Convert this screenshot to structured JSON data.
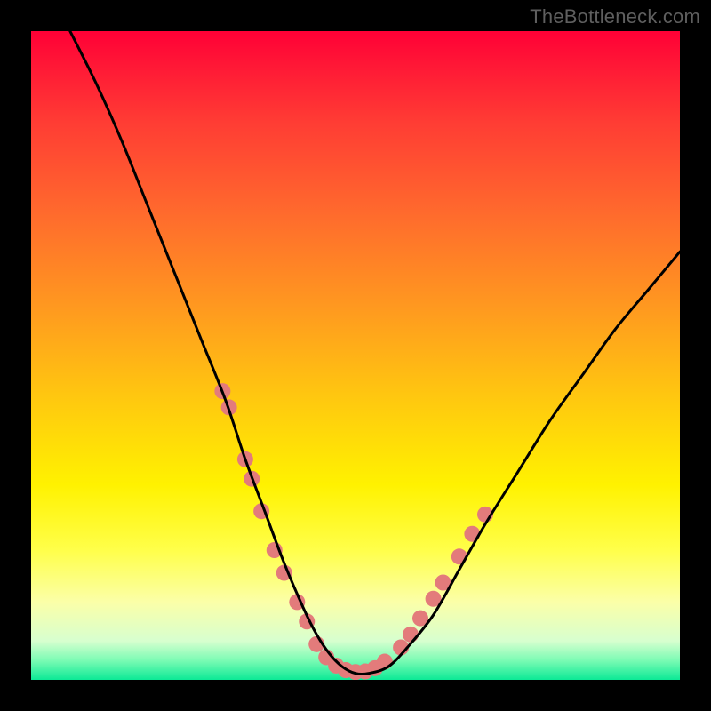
{
  "watermark": "TheBottleneck.com",
  "chart_data": {
    "type": "line",
    "title": "",
    "xlabel": "",
    "ylabel": "",
    "xlim": [
      0,
      100
    ],
    "ylim": [
      0,
      100
    ],
    "grid": false,
    "legend": false,
    "background_gradient": [
      "#ff0036",
      "#ffc610",
      "#ffff4a",
      "#0ce996"
    ],
    "series": [
      {
        "name": "bottleneck-curve",
        "color": "#000000",
        "x": [
          6,
          10,
          14,
          18,
          22,
          26,
          30,
          33,
          36,
          39,
          42,
          44,
          46,
          48,
          50,
          52,
          55,
          58,
          62,
          66,
          70,
          75,
          80,
          85,
          90,
          95,
          100
        ],
        "values": [
          100,
          92,
          83,
          73,
          63,
          53,
          43,
          34,
          26,
          18,
          11,
          7,
          4,
          2,
          1,
          1,
          2,
          5,
          10,
          17,
          24,
          32,
          40,
          47,
          54,
          60,
          66
        ]
      },
      {
        "name": "left-highlight-dots",
        "color": "#e37b7b",
        "marker": "circle",
        "x": [
          29.5,
          30.5,
          33.0,
          34.0,
          35.5,
          37.5,
          39.0,
          41.0,
          42.5
        ],
        "values": [
          44.5,
          42.0,
          34.0,
          31.0,
          26.0,
          20.0,
          16.5,
          12.0,
          9.0
        ]
      },
      {
        "name": "bottom-highlight-dots",
        "color": "#e37b7b",
        "marker": "circle",
        "x": [
          44.0,
          45.5,
          47.0,
          48.5,
          50.0,
          51.5,
          53.0,
          54.5
        ],
        "values": [
          5.5,
          3.5,
          2.2,
          1.5,
          1.2,
          1.3,
          1.8,
          2.8
        ]
      },
      {
        "name": "right-highlight-dots",
        "color": "#e37b7b",
        "marker": "circle",
        "x": [
          57.0,
          58.5,
          60.0,
          62.0,
          63.5,
          66.0,
          68.0,
          70.0
        ],
        "values": [
          5.0,
          7.0,
          9.5,
          12.5,
          15.0,
          19.0,
          22.5,
          25.5
        ]
      }
    ]
  }
}
